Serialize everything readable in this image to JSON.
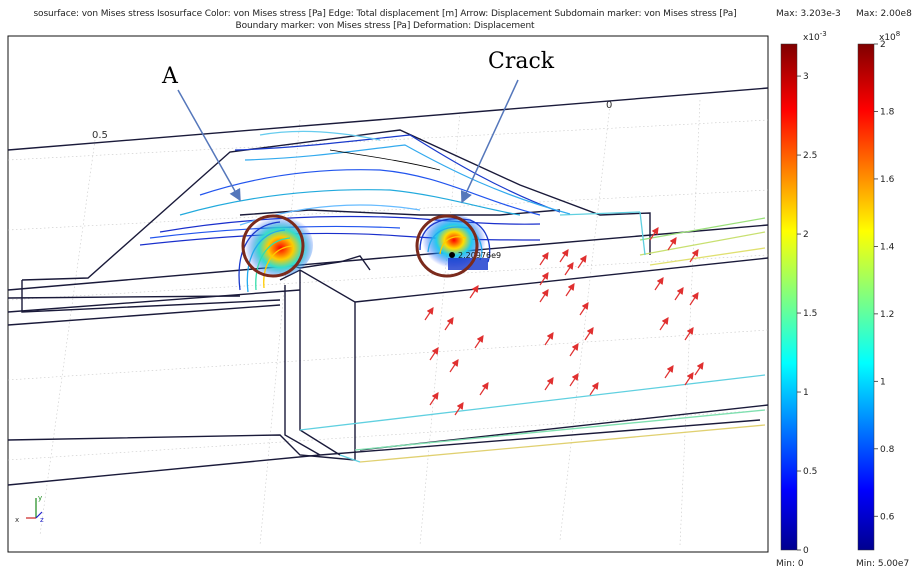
{
  "header": {
    "line1": "sosurface: von Mises stress   Isosurface Color: von Mises stress [Pa]   Edge: Total displacement [m]   Arrow: Displacement   Subdomain marker: von Mises stress [Pa]",
    "line2": "Boundary marker: von Mises stress [Pa]   Deformation: Displacement"
  },
  "annotations": {
    "label_a": "A",
    "label_crack": "Crack",
    "point_value": "2.20976e9",
    "tick_05": "0.5",
    "tick_0": "0"
  },
  "axis_triad": {
    "x": "x",
    "y": "y",
    "z": "z"
  },
  "colorbar_left": {
    "max_label": "Max: 3.203e-3",
    "min_label": "Min: 0",
    "exponent": "x10",
    "exponent_power": "-3",
    "ticks": [
      "3",
      "2.5",
      "2",
      "1.5",
      "1",
      "0.5",
      "0"
    ]
  },
  "colorbar_right": {
    "max_label": "Max: 2.00e8",
    "min_label": "Min: 5.00e7",
    "exponent": "x10",
    "exponent_power": "8",
    "ticks": [
      "2",
      "1.8",
      "1.6",
      "1.4",
      "1.2",
      "1",
      "0.8",
      "0.6"
    ]
  },
  "colors": {
    "hot_spot": "#ff2200",
    "arrow": "#e03030",
    "circle": "#7b2a1c",
    "frame": "#111111"
  }
}
